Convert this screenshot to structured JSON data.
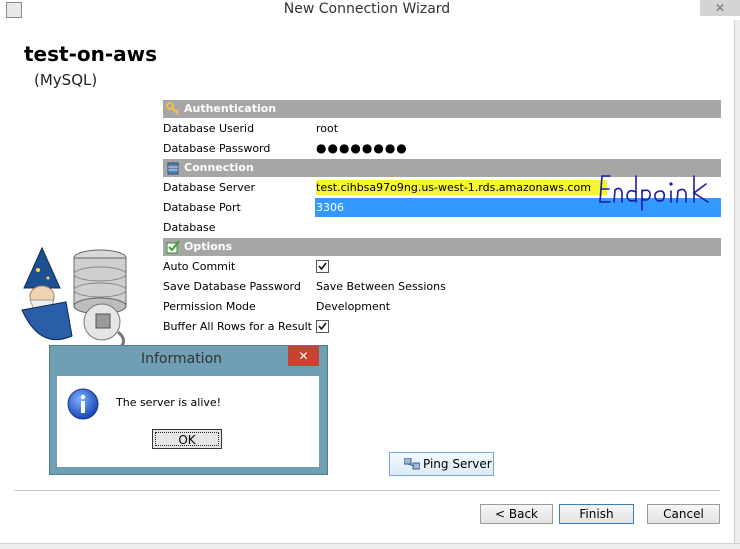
{
  "window": {
    "title": "New Connection Wizard",
    "close_glyph": "✕"
  },
  "connection": {
    "name": "test-on-aws",
    "type": "(MySQL)"
  },
  "sections": {
    "authentication": "Authentication",
    "connection": "Connection",
    "options": "Options"
  },
  "fields": {
    "userid_label": "Database Userid",
    "userid_value": "root",
    "password_label": "Database Password",
    "password_value": "●●●●●●●●",
    "server_label": "Database Server",
    "server_value": "test.cihbsa97o9ng.us-west-1.rds.amazonaws.com",
    "port_label": "Database Port",
    "port_value": "3306",
    "database_label": "Database",
    "database_value": "",
    "autocommit_label": "Auto Commit",
    "autocommit_checked": true,
    "save_pw_label": "Save Database Password",
    "save_pw_value": "Save Between Sessions",
    "permission_label": "Permission Mode",
    "permission_value": "Development",
    "buffer_label": "Buffer All Rows for a Result",
    "buffer_checked": true
  },
  "annotation": {
    "handwriting_text": "Endpoint",
    "highlight_color": "#f5f531",
    "ink_color": "#1a1aa6"
  },
  "dialog": {
    "title": "Information",
    "message": "The server is alive!",
    "ok_label": "OK",
    "close_glyph": "✕"
  },
  "buttons": {
    "ping": "Ping Server",
    "back": "< Back",
    "finish": "Finish",
    "cancel": "Cancel"
  },
  "colors": {
    "section_header": "#a6a6a6",
    "selection": "#3399ff",
    "dialog_frame": "#6f9fb4",
    "dialog_close": "#c7432f"
  }
}
